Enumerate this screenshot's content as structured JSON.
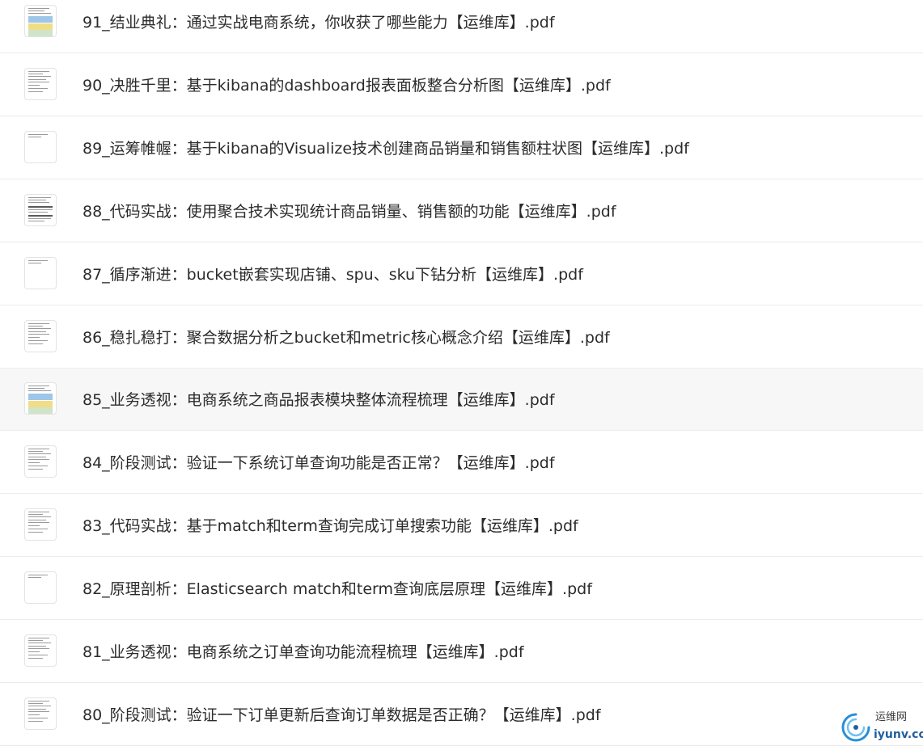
{
  "files": [
    {
      "name": "91_结业典礼：通过实战电商系统，你收获了哪些能力【运维库】.pdf",
      "thumb": "colored",
      "highlighted": false
    },
    {
      "name": "90_决胜千里：基于kibana的dashboard报表面板整合分析图【运维库】.pdf",
      "thumb": "text",
      "highlighted": false
    },
    {
      "name": "89_运筹帷幄：基于kibana的Visualize技术创建商品销量和销售额柱状图【运维库】.pdf",
      "thumb": "sparse",
      "highlighted": false
    },
    {
      "name": "88_代码实战：使用聚合技术实现统计商品销量、销售额的功能【运维库】.pdf",
      "thumb": "dark",
      "highlighted": false
    },
    {
      "name": "87_循序渐进：bucket嵌套实现店铺、spu、sku下钻分析【运维库】.pdf",
      "thumb": "sparse",
      "highlighted": false
    },
    {
      "name": "86_稳扎稳打：聚合数据分析之bucket和metric核心概念介绍【运维库】.pdf",
      "thumb": "text",
      "highlighted": false
    },
    {
      "name": "85_业务透视：电商系统之商品报表模块整体流程梳理【运维库】.pdf",
      "thumb": "colored",
      "highlighted": true
    },
    {
      "name": "84_阶段测试：验证一下系统订单查询功能是否正常？【运维库】.pdf",
      "thumb": "text",
      "highlighted": false
    },
    {
      "name": "83_代码实战：基于match和term查询完成订单搜索功能【运维库】.pdf",
      "thumb": "text",
      "highlighted": false
    },
    {
      "name": "82_原理剖析：Elasticsearch match和term查询底层原理【运维库】.pdf",
      "thumb": "sparse",
      "highlighted": false
    },
    {
      "name": "81_业务透视：电商系统之订单查询功能流程梳理【运维库】.pdf",
      "thumb": "text",
      "highlighted": false
    },
    {
      "name": "80_阶段测试：验证一下订单更新后查询订单数据是否正确？【运维库】.pdf",
      "thumb": "text",
      "highlighted": false
    }
  ],
  "watermark": {
    "cn": "运维网",
    "en": "iyunv.com",
    "icon": "swirl-logo-icon"
  }
}
